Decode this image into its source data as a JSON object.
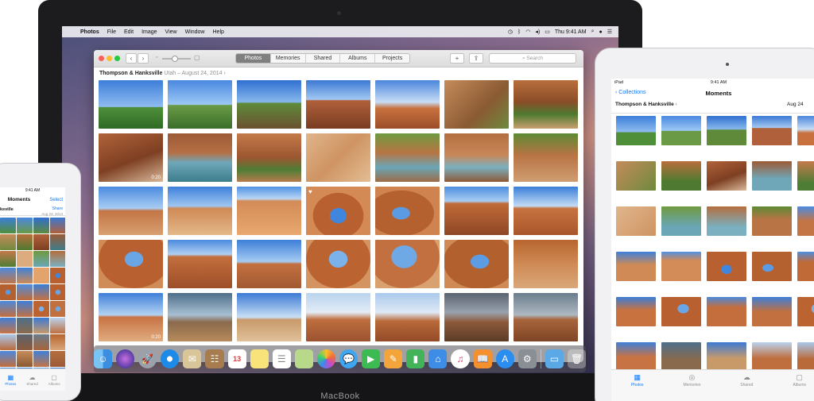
{
  "macbook": {
    "label": "MacBook",
    "menubar": {
      "items": [
        "Photos",
        "File",
        "Edit",
        "Image",
        "View",
        "Window",
        "Help"
      ],
      "clock": "Thu 9:41 AM"
    },
    "photos": {
      "tabs": [
        "Photos",
        "Memories",
        "Shared",
        "Albums",
        "Projects"
      ],
      "active_tab": "Photos",
      "search_placeholder": "Search",
      "add_label": "+",
      "breadcrumb": {
        "place": "Thompson & Hanksville",
        "state": "Utah",
        "date": "August 24, 2014"
      },
      "video_durations": {
        "v1": "0:20",
        "v2": "0:20"
      }
    },
    "dock_icons": [
      "finder-icon",
      "siri-icon",
      "launchpad-icon",
      "safari-icon",
      "mail-icon",
      "contacts-icon",
      "calendar-icon",
      "notes-icon",
      "reminders-icon",
      "maps-icon",
      "photos-icon",
      "messages-icon",
      "facetime-icon",
      "pages-icon",
      "numbers-icon",
      "keynote-icon",
      "itunes-icon",
      "ibooks-icon",
      "app-store-icon",
      "system-preferences-icon",
      "downloads-icon",
      "trash-icon"
    ]
  },
  "iphone": {
    "time": "9:41 AM",
    "title": "Moments",
    "select": "Select",
    "location": "ksville",
    "share": "Share",
    "date": "Aug 24, 2014",
    "tabs": [
      "Photos",
      "Shared",
      "Albums"
    ]
  },
  "ipad": {
    "carrier": "iPad",
    "time": "9:41 AM",
    "back": "Collections",
    "title": "Moments",
    "location": "Thompson & Hanksville",
    "date": "Aug 24",
    "tabs": [
      "Photos",
      "Memories",
      "Shared",
      "Albums"
    ]
  },
  "colors": {
    "accent": "#0a7aff",
    "sky": "#4d8fd8",
    "sandstone": "#c46a3c",
    "sand": "#dba476"
  }
}
